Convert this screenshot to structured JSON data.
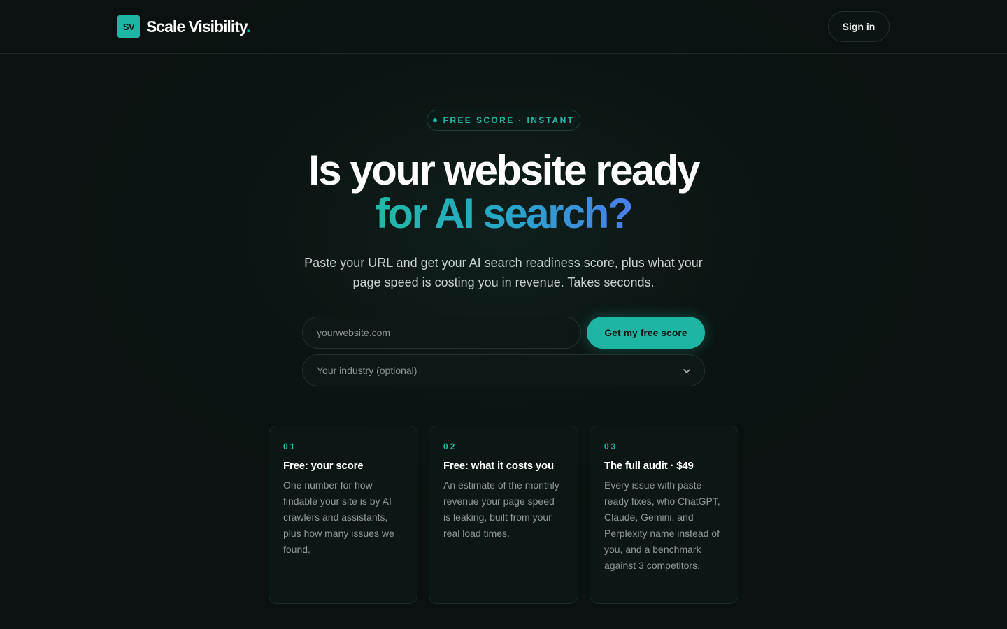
{
  "header": {
    "logo_mark": "SV",
    "logo_text": "Scale Visibility",
    "logo_dot": ".",
    "signin_label": "Sign in"
  },
  "hero": {
    "badge": "FREE SCORE · INSTANT",
    "title_line1": "Is your website ready",
    "title_line2": "for AI search?",
    "subtitle": "Paste your URL and get your AI search readiness score, plus what your page speed is costing you in revenue. Takes seconds."
  },
  "form": {
    "url_placeholder": "yourwebsite.com",
    "cta_label": "Get my free score",
    "industry_placeholder": "Your industry (optional)"
  },
  "cards": [
    {
      "num": "01",
      "title": "Free: your score",
      "body": "One number for how findable your site is by AI crawlers and assistants, plus how many issues we found."
    },
    {
      "num": "02",
      "title": "Free: what it costs you",
      "body": "An estimate of the monthly revenue your page speed is leaking, built from your real load times."
    },
    {
      "num": "03",
      "title": "The full audit · $49",
      "body": "Every issue with paste-ready fixes, who ChatGPT, Claude, Gemini, and Perplexity name instead of you, and a benchmark against 3 competitors."
    }
  ],
  "colors": {
    "accent": "#1fb5a3",
    "background": "#0a1110",
    "gradient_end": "#4a7fe8"
  }
}
